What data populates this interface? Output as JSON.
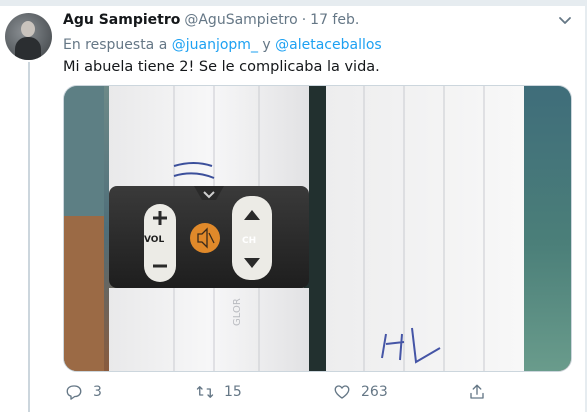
{
  "tweet": {
    "author_name": "Agu Sampietro",
    "handle": "@AguSampietro",
    "separator": "·",
    "date": "17 feb.",
    "reply_prefix": "En respuesta a",
    "reply_user_1": "@juanjopm_",
    "reply_conjunction": "y",
    "reply_user_2": "@aletaceballos",
    "text": "Mi abuela tiene 2! Se le complicaba la vida.",
    "media": {
      "label_vol": "VOL",
      "label_ch": "CH",
      "tape_text": "GLOR"
    }
  },
  "actions": {
    "replies": "3",
    "retweets": "15",
    "likes": "263"
  },
  "colors": {
    "link": "#1da1f2",
    "muted": "#657786",
    "thread_line": "#ccd6dd",
    "mute_button": "#e0892a"
  },
  "icons": [
    "chevron-down-icon",
    "reply-icon",
    "retweet-icon",
    "like-icon",
    "share-icon",
    "plus-icon",
    "minus-icon",
    "mute-icon",
    "up-arrow-icon",
    "down-arrow-icon"
  ]
}
